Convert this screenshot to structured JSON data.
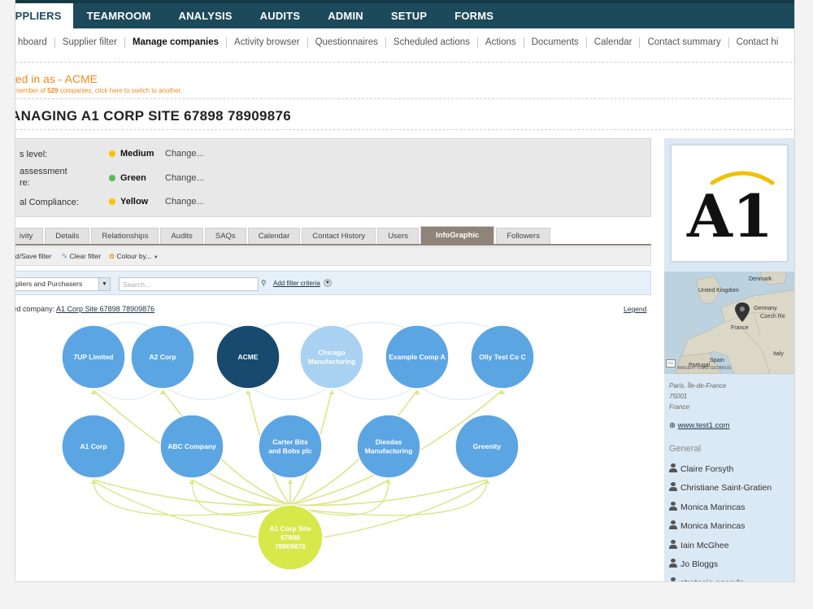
{
  "topnav": [
    "UPPLIERS",
    "TEAMROOM",
    "ANALYSIS",
    "AUDITS",
    "ADMIN",
    "SETUP",
    "FORMS"
  ],
  "subnav": [
    "hboard",
    "Supplier filter",
    "Manage companies",
    "Activity browser",
    "Questionnaires",
    "Scheduled actions",
    "Actions",
    "Documents",
    "Calendar",
    "Contact summary",
    "Contact hi"
  ],
  "header": {
    "logged_in": "ged in as - ACME",
    "member_note_prefix": "a member of ",
    "member_count": "529",
    "member_note_suffix": " companies, click here to switch to another.",
    "title": "ANAGING A1 CORP SITE 67898 78909876"
  },
  "status": [
    {
      "label": "s level:",
      "value": "Medium",
      "color": "#f5c400",
      "change": "Change..."
    },
    {
      "label": " assessment\nre:",
      "value": "Green",
      "color": "#5cb85c",
      "change": "Change..."
    },
    {
      "label": "al Compliance:",
      "value": "Yellow",
      "color": "#f5c400",
      "change": "Change..."
    }
  ],
  "tabs": [
    "ivity",
    "Details",
    "Relationships",
    "Audits",
    "SAQs",
    "Calendar",
    "Contact History",
    "Users",
    "InfoGraphic",
    "Followers"
  ],
  "active_tab": "InfoGraphic",
  "toolbar": {
    "load_save": "ad/Save filter",
    "clear": "Clear filter",
    "colour": "Colour by..."
  },
  "filter": {
    "select_value": "pliers and Purchasers",
    "search_placeholder": "Search...",
    "add_criteria": "Add filter criteria"
  },
  "selected": {
    "label": "ted company: ",
    "company": "A1 Corp Site 67898 78909876"
  },
  "legend": "Legend",
  "graph": {
    "row1": [
      {
        "label": "7UP Limited",
        "style": "blue"
      },
      {
        "label": "A2 Corp",
        "style": "blue"
      },
      {
        "label": "ACME",
        "style": "dark"
      },
      {
        "label": "Chicago Manufacturing",
        "style": "light"
      },
      {
        "label": "Example Comp A",
        "style": "blue"
      },
      {
        "label": "Olly Test Co C",
        "style": "blue"
      }
    ],
    "row2": [
      {
        "label": "A1 Corp",
        "style": "blue"
      },
      {
        "label": "ABC Company",
        "style": "blue"
      },
      {
        "label": "Carter Bits and Bobs plc",
        "style": "blue"
      },
      {
        "label": "Diesdas Manufacturing",
        "style": "blue"
      },
      {
        "label": "Greenity",
        "style": "blue"
      }
    ],
    "center": {
      "label": "A1 Corp Site 67898 78909876"
    },
    "colors": {
      "blue": "#5ca5e3",
      "dark": "#174a6e",
      "light": "#a9d1f2",
      "center": "#d6e84a",
      "link": "#dbe68a",
      "faint_link": "#e4eef6"
    }
  },
  "sidebar": {
    "logo_text": "A1",
    "map_labels": [
      "Denmark",
      "United Kingdom",
      "Germany",
      "Czech Re",
      "France",
      "Italy",
      "Spain",
      "Portugal"
    ],
    "map_attrib": "IMAGERY ©2016 GEOBASIS",
    "address": [
      "Paris, Île-de-France",
      "75001",
      "France"
    ],
    "website": "www.test1.com",
    "general": "General",
    "contacts": [
      "Claire Forsyth",
      "Christiane Saint-Gratien",
      "Monica Marincas",
      "Monica Marincas",
      "Iain McGhee",
      "Jo Bloggs",
      "strategic-agenda"
    ]
  }
}
